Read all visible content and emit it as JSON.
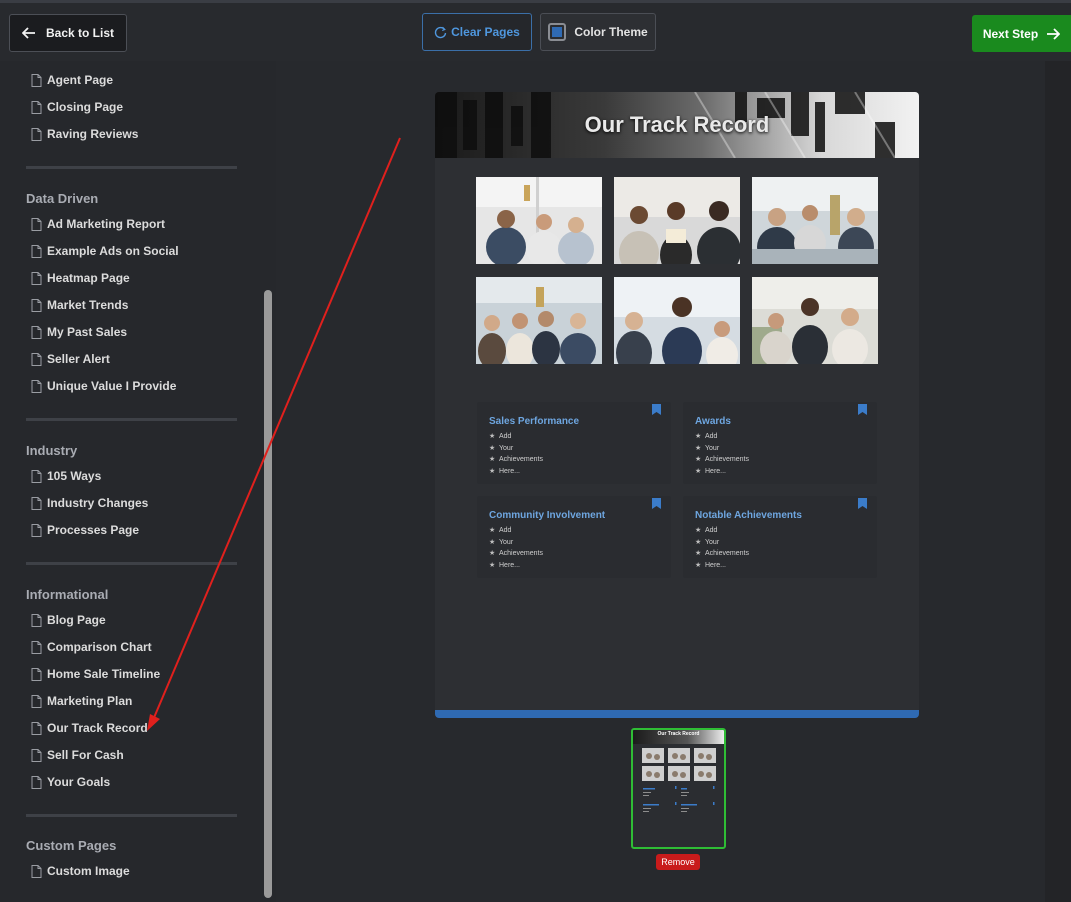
{
  "toolbar": {
    "back_label": "Back to List",
    "clear_label": "Clear Pages",
    "theme_label": "Color Theme",
    "next_label": "Next Step"
  },
  "sidebar": {
    "top_items": [
      "Agent Page",
      "Closing Page",
      "Raving Reviews"
    ],
    "categories": [
      {
        "title": "Data Driven",
        "items": [
          "Ad Marketing Report",
          "Example Ads on Social",
          "Heatmap Page",
          "Market Trends",
          "My Past Sales",
          "Seller Alert",
          "Unique Value I Provide"
        ]
      },
      {
        "title": "Industry",
        "items": [
          "105 Ways",
          "Industry Changes",
          "Processes Page"
        ]
      },
      {
        "title": "Informational",
        "items": [
          "Blog Page",
          "Comparison Chart",
          "Home Sale Timeline",
          "Marketing Plan",
          "Our Track Record",
          "Sell For Cash",
          "Your Goals"
        ]
      },
      {
        "title": "Custom Pages",
        "items": [
          "Custom Image"
        ]
      }
    ]
  },
  "preview": {
    "title": "Our Track Record",
    "cards": [
      {
        "title": "Sales Performance",
        "items": [
          "Add",
          "Your",
          "Achievements",
          "Here..."
        ]
      },
      {
        "title": "Awards",
        "items": [
          "Add",
          "Your",
          "Achievements",
          "Here..."
        ]
      },
      {
        "title": "Community Involvement",
        "items": [
          "Add",
          "Your",
          "Achievements",
          "Here..."
        ]
      },
      {
        "title": "Notable Achievements",
        "items": [
          "Add",
          "Your",
          "Achievements",
          "Here..."
        ]
      }
    ]
  },
  "thumbnail": {
    "title": "Our Track Record",
    "remove_label": "Remove"
  },
  "colors": {
    "accent_blue": "#2f6ab3",
    "next_green": "#1a8a1e",
    "remove_red": "#c91b1b",
    "annotation_arrow": "#e0201d"
  },
  "icons": {
    "back": "arrow-left-icon",
    "clear": "refresh-icon",
    "next": "arrow-right-icon",
    "page": "document-icon",
    "card": "bookmark-icon"
  }
}
